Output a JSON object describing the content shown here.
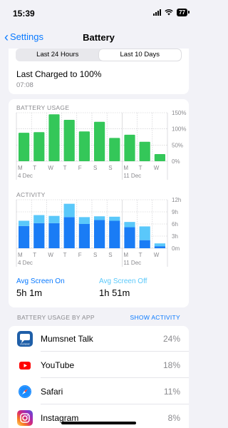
{
  "status": {
    "time": "15:39",
    "battery": "77"
  },
  "nav": {
    "back": "Settings",
    "title": "Battery"
  },
  "segments": [
    "Last 24 Hours",
    "Last 10 Days"
  ],
  "selected_segment": "Last 10 Days",
  "charge": {
    "text": "Last Charged to 100%",
    "time": "07:08"
  },
  "usage_label": "BATTERY USAGE",
  "activity_label": "ACTIVITY",
  "colors": {
    "usage": "#34c759",
    "screen_on": "#1a7cf5",
    "screen_off": "#5ac8fa",
    "grid": "#c7c7cc",
    "accent": "#0a7aff"
  },
  "chart_data": [
    {
      "type": "bar",
      "title": "BATTERY USAGE",
      "categories": [
        "M",
        "T",
        "W",
        "T",
        "F",
        "S",
        "S",
        "M",
        "T",
        "W"
      ],
      "date_labels": [
        "4 Dec",
        "11 Dec"
      ],
      "ytick_labels": [
        "150%",
        "100%",
        "50%",
        "0%"
      ],
      "ylim": [
        0,
        150
      ],
      "values": [
        88,
        90,
        145,
        128,
        92,
        122,
        72,
        82,
        60,
        22
      ]
    },
    {
      "type": "bar",
      "stacked": true,
      "title": "ACTIVITY",
      "categories": [
        "M",
        "T",
        "W",
        "T",
        "F",
        "S",
        "S",
        "M",
        "T",
        "W"
      ],
      "date_labels": [
        "4 Dec",
        "11 Dec"
      ],
      "ytick_labels": [
        "12h",
        "9h",
        "6h",
        "3h",
        "0m"
      ],
      "ylim": [
        0,
        12
      ],
      "series": [
        {
          "values": [
            5.5,
            6.2,
            6.2,
            7.7,
            6.0,
            7.0,
            6.8,
            5.2,
            2.0,
            0.5
          ]
        },
        {
          "values": [
            1.3,
            2.0,
            1.8,
            3.3,
            1.7,
            0.9,
            1.0,
            1.3,
            3.4,
            0.7
          ]
        }
      ]
    }
  ],
  "avg_on": {
    "label": "Avg Screen On",
    "value": "5h 1m"
  },
  "avg_off": {
    "label": "Avg Screen Off",
    "value": "1h 51m"
  },
  "by_app_label": "BATTERY USAGE BY APP",
  "show_activity": "SHOW ACTIVITY",
  "apps": [
    {
      "name": "Mumsnet Talk",
      "pct": "24%",
      "icon": "mumsnet-icon",
      "icon_text": "mumsnet",
      "color": "#1f5fa8"
    },
    {
      "name": "YouTube",
      "pct": "18%",
      "icon": "youtube-icon",
      "color": "#ff0000"
    },
    {
      "name": "Safari",
      "pct": "11%",
      "icon": "safari-icon",
      "color": "#1a8cff"
    },
    {
      "name": "Instagram",
      "pct": "8%",
      "icon": "instagram-icon",
      "color": "#d62976"
    }
  ]
}
